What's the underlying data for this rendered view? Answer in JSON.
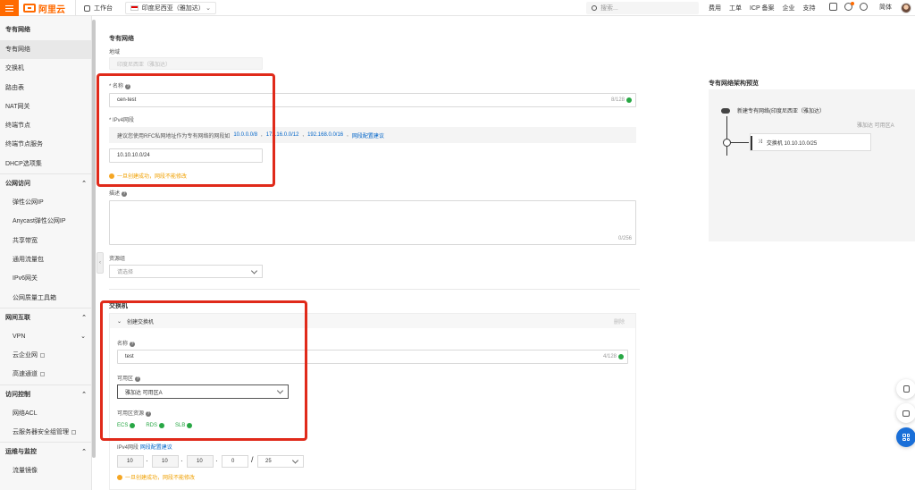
{
  "topbar": {
    "brand": "阿里云",
    "workbench": "工作台",
    "region": "印度尼西亚（雅加达）",
    "search_placeholder": "搜索...",
    "links": [
      "费用",
      "工单",
      "ICP 备案",
      "企业",
      "支持"
    ],
    "language": "简体"
  },
  "sidebar": {
    "title": "专有网络",
    "items": [
      "专有网络",
      "交换机",
      "路由表",
      "NAT网关",
      "终端节点",
      "终端节点服务",
      "DHCP选项集"
    ],
    "groups": [
      {
        "label": "公网访问",
        "items": [
          "弹性公网IP",
          "Anycast弹性公网IP",
          "共享带宽",
          "通用流量包",
          "IPv6网关",
          "公网质量工具箱"
        ]
      },
      {
        "label": "网间互联",
        "items": [
          "VPN",
          "云企业网",
          "高速通道"
        ]
      },
      {
        "label": "访问控制",
        "items": [
          "网络ACL",
          "云服务器安全组管理"
        ]
      },
      {
        "label": "运维与监控",
        "items": [
          "流量镜像"
        ]
      }
    ]
  },
  "form": {
    "section_title": "专有网络",
    "region_label": "地域",
    "region_value": "印度尼西亚（雅加达）",
    "name_label": "* 名称",
    "name_value": "cen-test",
    "name_counter": "8/128",
    "ipv4_label": "* IPv4网段",
    "ipv4_hint": "建议您使用RFC私网地址作为专有网络的网段如",
    "ipv4_suggestions": [
      "10.0.0.0/8",
      "172.16.0.0/12",
      "192.168.0.0/16"
    ],
    "ipv4_hint_link": "网段配置建议",
    "ipv4_value": "10.10.10.0/24",
    "ipv4_warning": "一旦创建成功，网段不能修改",
    "desc_label": "描述",
    "desc_counter": "0/256",
    "rg_label": "资源组",
    "rg_placeholder": "请选择"
  },
  "vswitch": {
    "section_title": "交换机",
    "panel_title": "创建交换机",
    "delete_label": "删除",
    "name_label": "名称",
    "name_value": "test",
    "name_counter": "4/128",
    "zone_label": "可用区",
    "zone_value": "雅加达 可用区A",
    "zone_res_label": "可用区资源",
    "resources": [
      "ECS",
      "RDS",
      "SLB"
    ],
    "ipv4_label": "IPv4网段",
    "ipv4_link": "网段配置建议",
    "octets": [
      "10",
      "10",
      "10",
      "0"
    ],
    "mask": "25",
    "ipv4_warning": "一旦创建成功，网段不能修改"
  },
  "architecture": {
    "title": "专有网络架构预览",
    "vpc_label": "新建专有网络(印度尼西亚（雅加达）",
    "zone_label": "雅加达 可用区A",
    "switch_label": "交换机 10.10.10.0/25"
  },
  "colors": {
    "accent": "#ff6a00",
    "link": "#0064c8",
    "highlight": "#e02a1a",
    "ok": "#28a745"
  }
}
